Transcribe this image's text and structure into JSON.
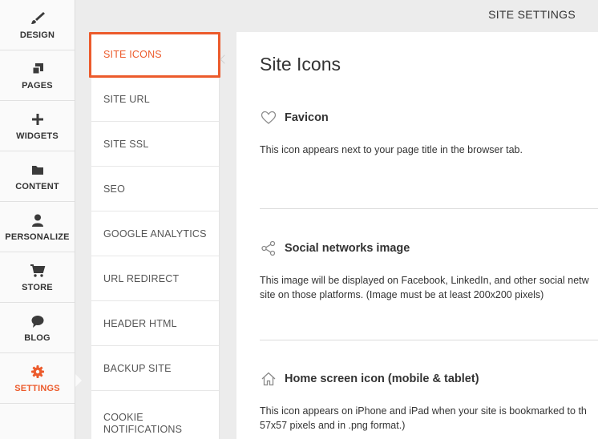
{
  "rail": {
    "items": [
      {
        "label": "DESIGN",
        "icon": "brush-icon"
      },
      {
        "label": "PAGES",
        "icon": "pages-icon"
      },
      {
        "label": "WIDGETS",
        "icon": "plus-icon"
      },
      {
        "label": "CONTENT",
        "icon": "folder-icon"
      },
      {
        "label": "PERSONALIZE",
        "icon": "person-icon"
      },
      {
        "label": "STORE",
        "icon": "cart-icon"
      },
      {
        "label": "BLOG",
        "icon": "chat-bubble-icon"
      },
      {
        "label": "SETTINGS",
        "icon": "gear-icon",
        "active": true
      }
    ]
  },
  "topbar": {
    "title": "SITE SETTINGS"
  },
  "menu": {
    "items": [
      {
        "label": "SITE ICONS",
        "active": true
      },
      {
        "label": "SITE URL"
      },
      {
        "label": "SITE SSL"
      },
      {
        "label": "SEO"
      },
      {
        "label": "GOOGLE ANALYTICS"
      },
      {
        "label": "URL REDIRECT"
      },
      {
        "label": "HEADER HTML"
      },
      {
        "label": "BACKUP SITE"
      },
      {
        "label": "COOKIE NOTIFICATIONS",
        "line1": "COOKIE",
        "line2": "NOTIFICATIONS"
      }
    ]
  },
  "panel": {
    "title": "Site Icons",
    "sections": [
      {
        "icon": "heart-icon",
        "title": "Favicon",
        "desc_lines": [
          "This icon appears next to your page title in the browser tab."
        ]
      },
      {
        "icon": "share-icon",
        "title": "Social networks image",
        "desc_lines": [
          "This image will be displayed on Facebook, LinkedIn, and other social netw",
          "site on those platforms. (Image must be at least 200x200 pixels)"
        ]
      },
      {
        "icon": "home-icon",
        "title": "Home screen icon (mobile & tablet)",
        "desc_lines": [
          "This icon appears on iPhone and iPad when your site is bookmarked to th",
          "57x57 pixels and in .png format.)"
        ]
      }
    ]
  },
  "colors": {
    "accent": "#ec5b2c",
    "rail_bg": "#fafafa",
    "page_bg": "#ececec"
  }
}
